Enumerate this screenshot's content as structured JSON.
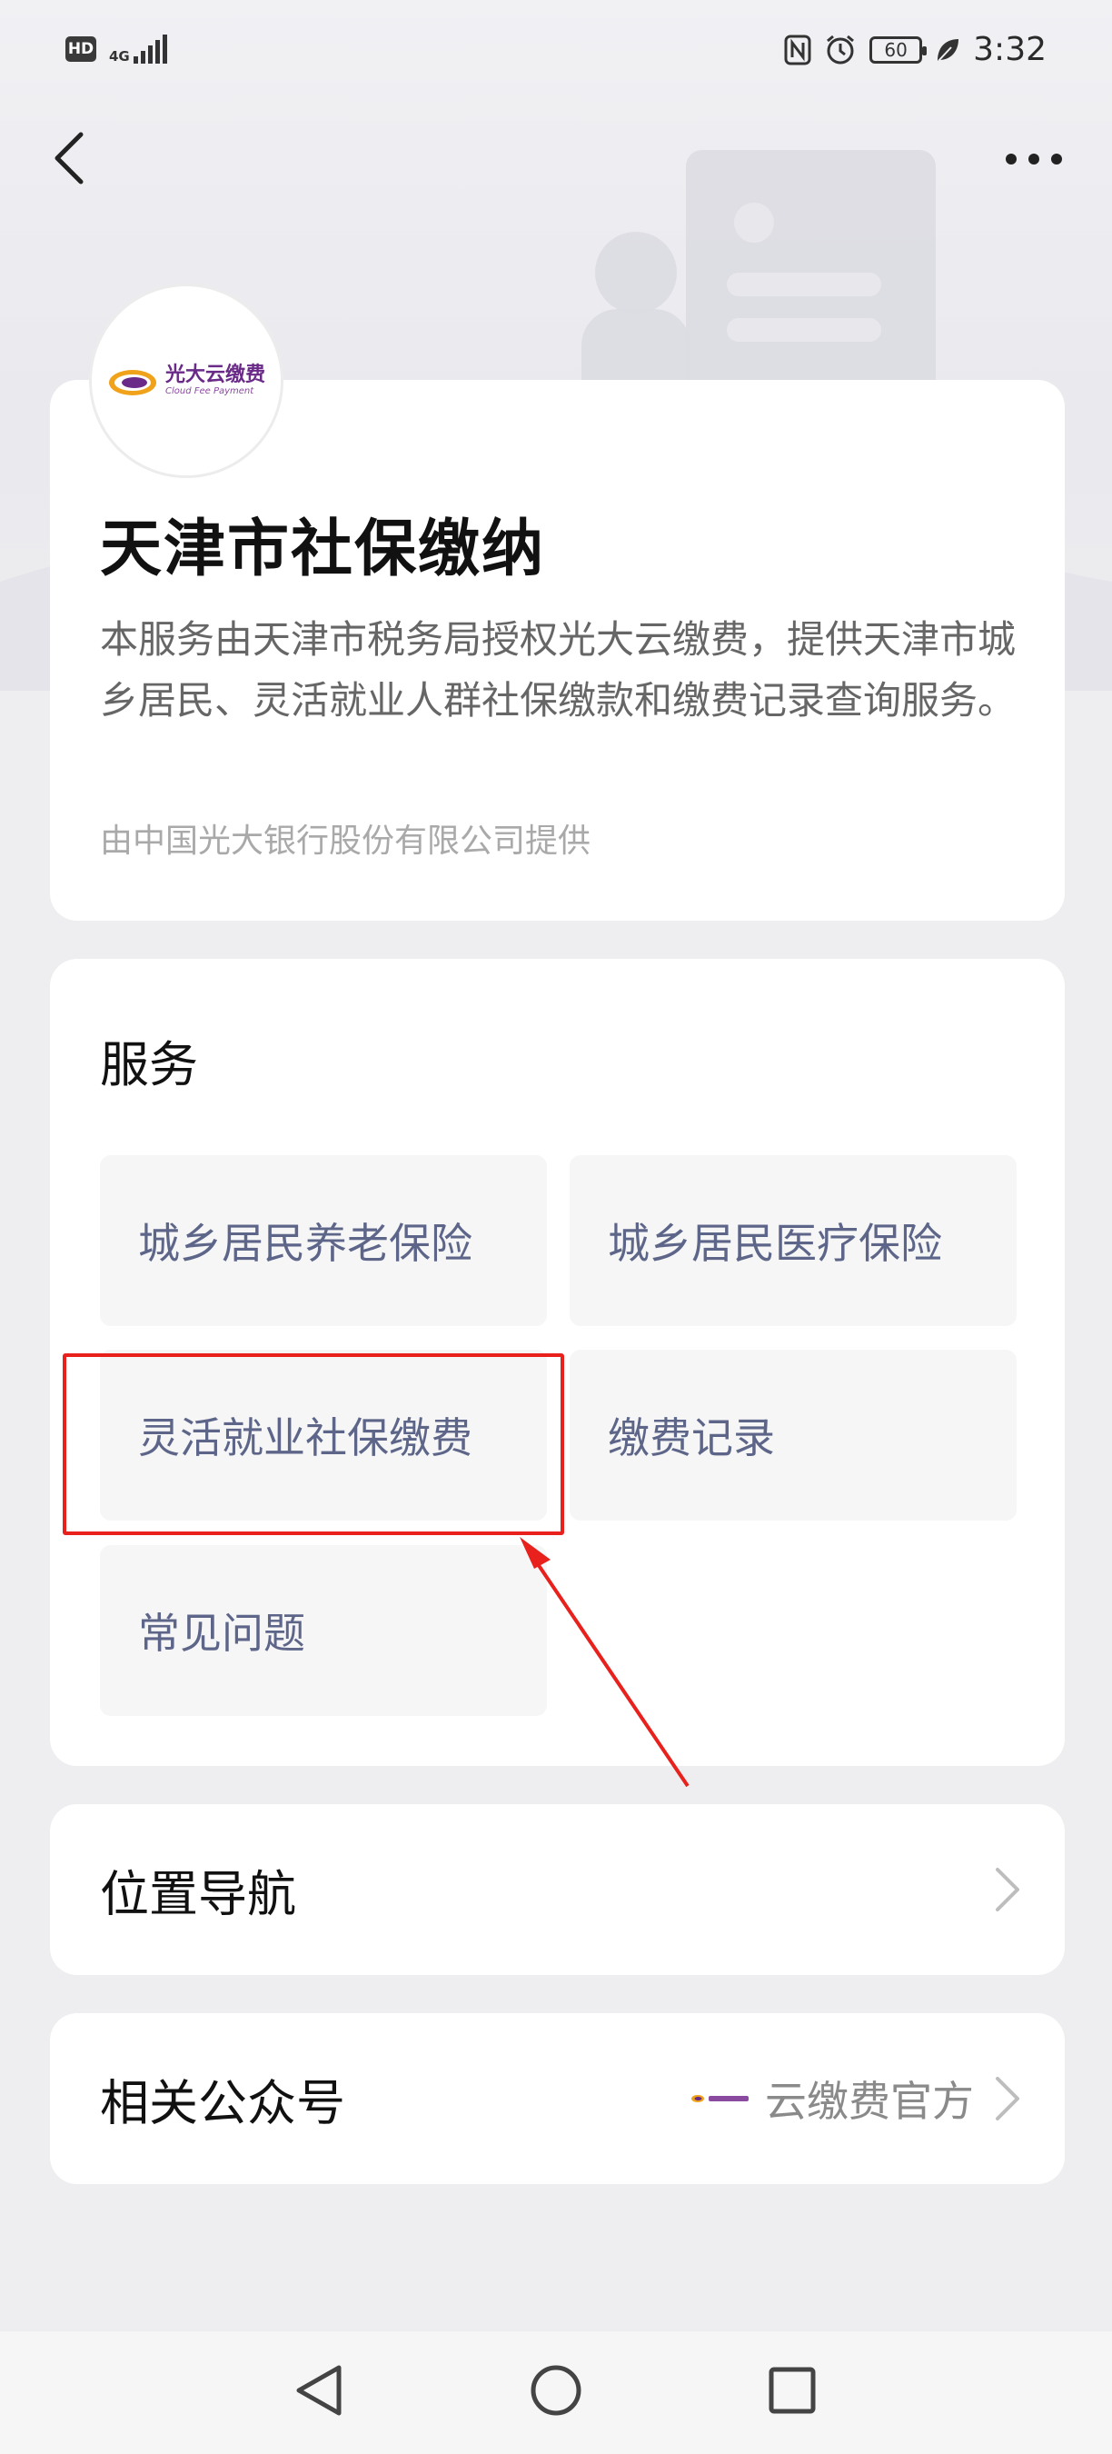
{
  "status_bar": {
    "hd_label": "HD",
    "network_label": "4G",
    "battery_level": "60",
    "time": "3:32"
  },
  "nav": {
    "back_icon": "chevron-left-icon",
    "more_icon": "more-horizontal-icon"
  },
  "intro": {
    "logo": {
      "name_cn": "光大云缴费",
      "name_en": "Cloud Fee Payment"
    },
    "title": "天津市社保缴纳",
    "description": "本服务由天津市税务局授权光大云缴费，提供天津市城乡居民、灵活就业人群社保缴款和缴费记录查询服务。",
    "provider": "由中国光大银行股份有限公司提供"
  },
  "services": {
    "title": "服务",
    "items": [
      {
        "label": "城乡居民养老保险"
      },
      {
        "label": "城乡居民医疗保险"
      },
      {
        "label": "灵活就业社保缴费"
      },
      {
        "label": "缴费记录"
      },
      {
        "label": "常见问题"
      }
    ]
  },
  "location": {
    "label": "位置导航"
  },
  "account": {
    "label": "相关公众号",
    "name": "云缴费官方"
  },
  "annotation": {
    "color": "#e8211d"
  },
  "colors": {
    "service_text": "#5d6689",
    "page_bg": "#eeeef0"
  }
}
